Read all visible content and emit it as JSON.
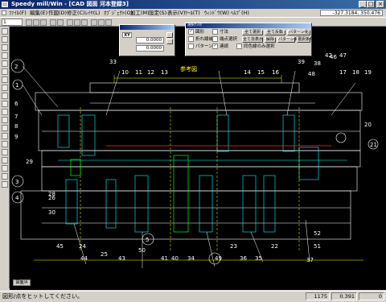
{
  "window": {
    "title": "Speedy mill/Win - [CAD 図面 河本登録3]",
    "controls": {
      "minimize": "_",
      "maximize": "□",
      "close": "×"
    }
  },
  "menubar": {
    "items": [
      "ﾌｧｲﾙ(F)",
      "編集(E)",
      "作図(D)",
      "修正(C)",
      "ﾚｲﾔ(L)",
      "ｵﾌﾞｼﾞｪｸﾄ(O)",
      "加工(M)",
      "設定(S)",
      "表示(V)",
      "ﾂｰﾙ(T)",
      "ｳｨﾝﾄﾞｳ(W)",
      "ﾍﾙﾌﾟ(H)"
    ],
    "coordinate": "-327.3184, 350.476"
  },
  "toolbar": {
    "layer_select": "1"
  },
  "input_panel": {
    "xy_label": "XY",
    "x_value": "0.0000",
    "y_value": "0.0000"
  },
  "select_panel": {
    "title": "選択ﾌｨﾙﾀ",
    "checkbox_1": "図形",
    "checkbox_2": "寸法",
    "checkbox_3": "折れ線補助",
    "checkbox_4": "端点選択",
    "checkbox_5": "パターン",
    "checkbox_6": "連続",
    "checkbox_7": "同色線のみ選択",
    "button_1": "全て選択",
    "button_2": "全て反転",
    "button_3": "パターン化",
    "button_4": "全て非表示",
    "button_5": "解除",
    "button_6": "パターン解除",
    "button_7": "選択条件"
  },
  "drawing": {
    "title": "参考図",
    "part_numbers": [
      "1",
      "2",
      "3",
      "4",
      "5",
      "6",
      "7",
      "8",
      "9",
      "10",
      "11",
      "12",
      "13",
      "14",
      "15",
      "16",
      "17",
      "18",
      "19",
      "20",
      "21",
      "22",
      "23",
      "24",
      "25",
      "26",
      "28",
      "29",
      "30",
      "33",
      "34",
      "35",
      "36",
      "37",
      "38",
      "39",
      "40",
      "41",
      "42",
      "43",
      "44",
      "45",
      "46",
      "47",
      "48",
      "49",
      "50",
      "51",
      "52"
    ],
    "corner_tab": "図面/A"
  },
  "status": {
    "message": "図形/点をヒットしてください。",
    "value_1": "1175",
    "value_2": "0.391",
    "value_3": "0"
  },
  "colors": {
    "canvas": "#000000",
    "line_white": "#ffffff",
    "line_cyan": "#00ffff",
    "line_yellow": "#ffff00",
    "line_green": "#00ff00",
    "line_red": "#ff3030",
    "title_bar": "#0a246a"
  }
}
